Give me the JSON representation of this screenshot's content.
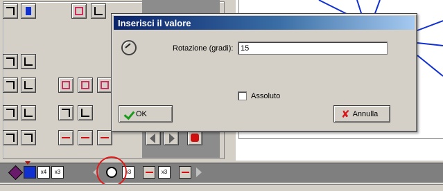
{
  "dialog": {
    "title": "Inserisci il valore",
    "field_label": "Rotazione (gradi):",
    "field_value": "15",
    "checkbox_label": "Assoluto",
    "checkbox_checked": false,
    "ok_label": "OK",
    "cancel_label": "Annulla"
  },
  "bottom_toolbar": {
    "items": [
      "x4",
      "x3",
      "x3",
      "x3"
    ]
  },
  "colors": {
    "titlebar": "#0a246a",
    "ok_icon": "#1a9a1a",
    "cancel_icon": "#d81818",
    "highlight_circle": "#e01818",
    "canvas_lines": "#1030d0"
  }
}
